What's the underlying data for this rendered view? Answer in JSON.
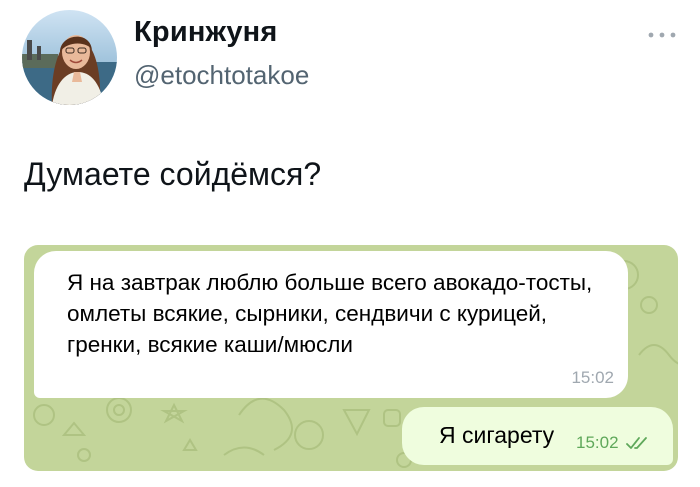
{
  "profile": {
    "display_name": "Кринжуня",
    "handle": "@etochtotakoe"
  },
  "tweet": {
    "text": "Думаете сойдёмся?"
  },
  "chat": {
    "incoming": {
      "text": "Я на завтрак люблю больше всего авокадо-тосты, омлеты всякие, сырники, сендвичи с курицей, гренки, всякие каши/мюсли",
      "time": "15:02"
    },
    "outgoing": {
      "text": "Я сигарету",
      "time": "15:02",
      "status_icon": "double-check-icon"
    }
  },
  "icons": {
    "more": "more-horizontal-icon",
    "avatar": "avatar-photo"
  },
  "colors": {
    "chat_background": "#c3d59a",
    "incoming_bubble": "#ffffff",
    "outgoing_bubble": "#effdde",
    "outgoing_time": "#5fa85a",
    "handle_text": "#536471"
  }
}
